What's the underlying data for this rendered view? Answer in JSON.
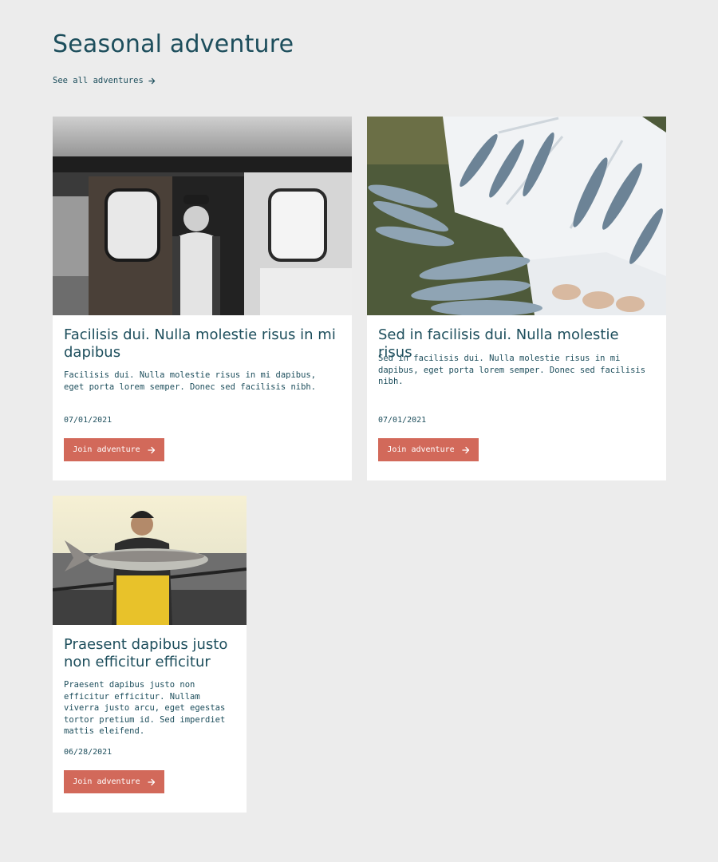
{
  "section": {
    "title": "Seasonal adventure",
    "see_all_label": "See all adventures",
    "see_all_icon": "arrow-right-icon"
  },
  "colors": {
    "heading": "#1d4e5c",
    "background": "#ececec",
    "card": "#ffffff",
    "button": "#d2695a"
  },
  "cards": [
    {
      "image_alt": "smiling fisherman in the cabin doorway of a boat",
      "title": "Facilisis dui. Nulla molestie risus in mi dapibus",
      "description": "Facilisis dui. Nulla molestie risus in mi dapibus, eget porta lorem semper. Donec sed facilisis nibh.",
      "date": "07/01/2021",
      "button_label": "Join adventure",
      "button_icon": "arrow-right-icon"
    },
    {
      "image_alt": "crates of fresh mackerel on ice",
      "title": "Sed in facilisis dui. Nulla molestie risus",
      "description": "Sed in facilisis dui. Nulla molestie risus in mi dapibus, eget porta lorem semper. Donec sed facilisis nibh.",
      "date": "07/01/2021",
      "button_label": "Join adventure",
      "button_icon": "arrow-right-icon"
    },
    {
      "image_alt": "fisherman holding a large salmon on a boat",
      "title": "Praesent dapibus justo non efficitur efficitur",
      "description": "Praesent dapibus justo non efficitur efficitur. Nullam viverra justo arcu, eget egestas tortor pretium id. Sed imperdiet mattis eleifend.",
      "date": "06/28/2021",
      "button_label": "Join adventure",
      "button_icon": "arrow-right-icon"
    }
  ]
}
